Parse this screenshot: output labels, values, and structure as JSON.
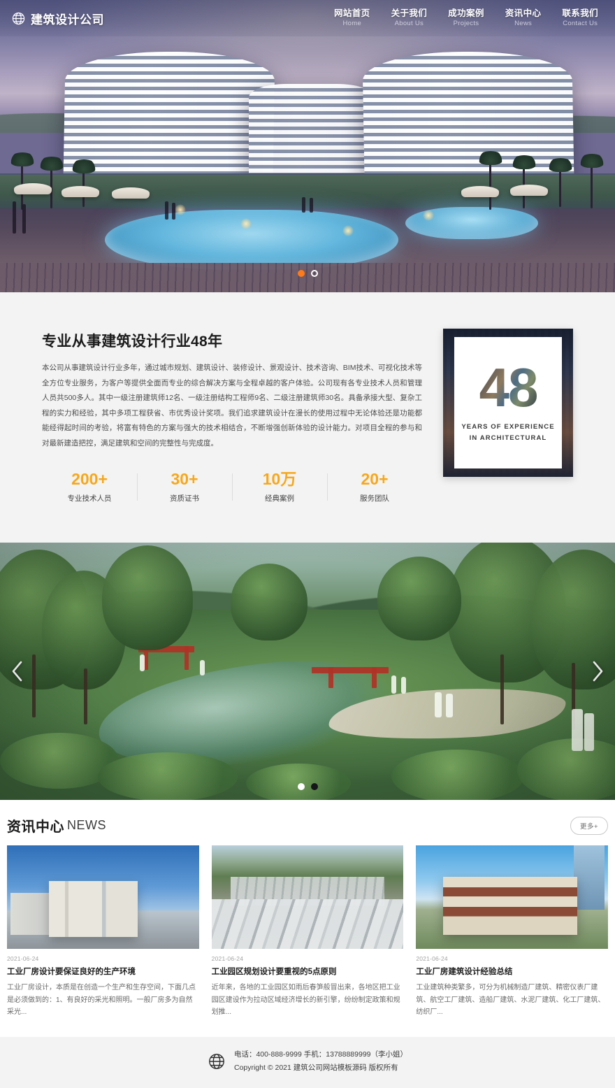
{
  "site": {
    "logo_text": "建筑设计公司",
    "logo_icon": "globe-icon"
  },
  "nav": {
    "items": [
      {
        "cn": "网站首页",
        "en": "Home"
      },
      {
        "cn": "关于我们",
        "en": "About Us"
      },
      {
        "cn": "成功案例",
        "en": "Projects"
      },
      {
        "cn": "资讯中心",
        "en": "News"
      },
      {
        "cn": "联系我们",
        "en": "Contact Us"
      }
    ]
  },
  "hero": {
    "dots": [
      {
        "active": true
      },
      {
        "active": false
      }
    ]
  },
  "about": {
    "title": "专业从事建筑设计行业48年",
    "paragraph": "本公司从事建筑设计行业多年，通过城市规划、建筑设计、装修设计、景观设计、技术咨询、BIM技术、可视化技术等全方位专业服务，为客户等提供全面而专业的综合解决方案与全程卓越的客户体验。公司现有各专业技术人员和管理人员共500多人。其中一级注册建筑师12名、一级注册结构工程师9名、二级注册建筑师30名。具备承接大型、复杂工程的实力和经验，其中多项工程获省、市优秀设计奖项。我们追求建筑设计在漫长的使用过程中无论体验还是功能都能经得起时间的考验，将富有特色的方案与强大的技术相结合，不断增强创新体验的设计能力。对项目全程的参与和对最新建造把控，满足建筑和空间的完整性与完成度。",
    "stats": [
      {
        "num": "200+",
        "label": "专业技术人员"
      },
      {
        "num": "30+",
        "label": "资质证书"
      },
      {
        "num": "10万",
        "label": "经典案例"
      },
      {
        "num": "20+",
        "label": "服务团队"
      }
    ],
    "card": {
      "number": "48",
      "caption_line1": "YEARS OF EXPERIENCE",
      "caption_line2": "IN ARCHITECTURAL"
    },
    "accent_color": "#f6a81c",
    "background_color": "#f3f3f3"
  },
  "banner2": {
    "prev_icon": "chevron-left-icon",
    "next_icon": "chevron-right-icon",
    "dots": [
      {
        "active": false
      },
      {
        "active": true
      }
    ]
  },
  "news": {
    "title_cn": "资讯中心",
    "title_en": "NEWS",
    "more_label": "更多+",
    "cards": [
      {
        "date": "2021-06-24",
        "title": "工业厂房设计要保证良好的生产环境",
        "excerpt": "工业厂房设计，本质是在创造一个生产和生存空间，下面几点是必须做到的：1、有良好的采光和照明。一般厂房多为自然采光..."
      },
      {
        "date": "2021-06-24",
        "title": "工业园区规划设计要重视的5点原则",
        "excerpt": "近年来，各地的工业园区如雨后春笋般冒出来，各地区把工业园区建设作为拉动区域经济增长的新引擎，纷纷制定政策和规划推..."
      },
      {
        "date": "2021-06-24",
        "title": "工业厂房建筑设计经验总结",
        "excerpt": "工业建筑种类繁多，可分为机械制造厂建筑、精密仪表厂建筑、航空工厂建筑、造船厂建筑、水泥厂建筑、化工厂建筑、纺织厂..."
      }
    ]
  },
  "footer": {
    "icon": "globe-icon",
    "contact_line": "电话：400-888-9999  手机：13788889999（李小姐）",
    "copyright_line": "Copyright © 2021 建筑公司网站模板源码 版权所有"
  }
}
